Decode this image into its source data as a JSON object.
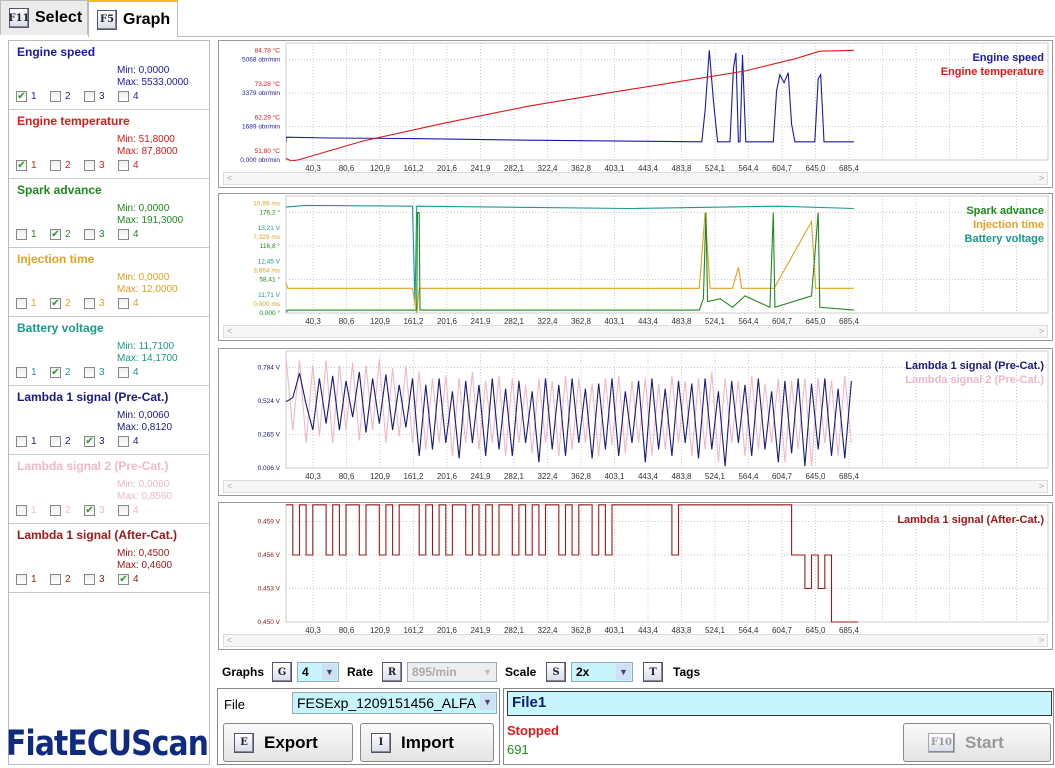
{
  "tabs": [
    {
      "key": "F11",
      "label": "Select"
    },
    {
      "key": "F5",
      "label": "Graph"
    }
  ],
  "signals": [
    {
      "name": "Engine speed",
      "min": "Min: 0,0000",
      "max": "Max: 5533,0000",
      "color": "#1a1aa8",
      "graph": 1
    },
    {
      "name": "Engine temperature",
      "min": "Min: 51,8000",
      "max": "Max: 87,8000",
      "color": "#e01818",
      "graph": 1
    },
    {
      "name": "Spark advance",
      "min": "Min: 0,0000",
      "max": "Max: 191,3000",
      "color": "#1e8a1e",
      "graph": 2
    },
    {
      "name": "Injection time",
      "min": "Min: 0,0000",
      "max": "Max: 12,0000",
      "color": "#e8a020",
      "graph": 2
    },
    {
      "name": "Battery voltage",
      "min": "Min: 11,7100",
      "max": "Max: 14,1700",
      "color": "#1a9a8a",
      "graph": 2
    },
    {
      "name": "Lambda 1 signal (Pre-Cat.)",
      "min": "Min: 0,0060",
      "max": "Max: 0,8120",
      "color": "#1a1a80",
      "graph": 3
    },
    {
      "name": "Lambda signal 2 (Pre-Cat.)",
      "min": "Min: 0,0060",
      "max": "Max: 0,8560",
      "color": "#f0b8c8",
      "graph": 3
    },
    {
      "name": "Lambda 1 signal (After-Cat.)",
      "min": "Min: 0,4500",
      "max": "Max: 0,4600",
      "color": "#a01818",
      "graph": 4
    }
  ],
  "checkbox_labels": [
    "1",
    "2",
    "3",
    "4"
  ],
  "x_ticks": [
    "40,3",
    "80,6",
    "120,9",
    "161,2",
    "201,6",
    "241,9",
    "282,1",
    "322,4",
    "362,8",
    "403,1",
    "443,4",
    "483,8",
    "524,1",
    "564,4",
    "604,7",
    "645,0",
    "685,4"
  ],
  "chart_data": [
    {
      "type": "line",
      "legend": [
        "Engine speed",
        "Engine temperature"
      ],
      "legend_position": "top-right",
      "y_labels": [
        [
          {
            "t": "51,80 °C",
            "c": "#e01818"
          },
          {
            "t": "0,000 obr/min",
            "c": "#1a1aa8"
          }
        ],
        [
          {
            "t": "62,29 °C",
            "c": "#e01818"
          },
          {
            "t": "1689 obr/min",
            "c": "#1a1aa8"
          }
        ],
        [
          {
            "t": "73,28 °C",
            "c": "#e01818"
          },
          {
            "t": "3379 obr/min",
            "c": "#1a1aa8"
          }
        ],
        [
          {
            "t": "84,78 °C",
            "c": "#e01818"
          },
          {
            "t": "5068 obr/min",
            "c": "#1a1aa8"
          }
        ]
      ],
      "series": [
        {
          "name": "Engine speed",
          "color": "#1a1aa8",
          "ylim": [
            0,
            5068
          ],
          "points": [
            [
              0,
              0
            ],
            [
              5,
              0
            ],
            [
              8,
              1150
            ],
            [
              60,
              1110
            ],
            [
              161,
              1080
            ],
            [
              300,
              1000
            ],
            [
              480,
              930
            ],
            [
              508,
              920
            ],
            [
              512,
              2500
            ],
            [
              517,
              5533
            ],
            [
              522,
              3000
            ],
            [
              527,
              920
            ],
            [
              542,
              920
            ],
            [
              546,
              4600
            ],
            [
              549,
              5400
            ],
            [
              552,
              920
            ],
            [
              554,
              920
            ],
            [
              557,
              5300
            ],
            [
              561,
              920
            ],
            [
              594,
              920
            ],
            [
              598,
              3500
            ],
            [
              602,
              4300
            ],
            [
              607,
              3900
            ],
            [
              612,
              4400
            ],
            [
              616,
              1800
            ],
            [
              620,
              920
            ],
            [
              644,
              920
            ],
            [
              648,
              4100
            ],
            [
              651,
              4300
            ],
            [
              655,
              920
            ],
            [
              691,
              920
            ]
          ]
        },
        {
          "name": "Engine temperature",
          "color": "#e01818",
          "ylim": [
            51.8,
            84.78
          ],
          "points": [
            [
              0,
              52.6
            ],
            [
              6,
              52.6
            ],
            [
              14,
              51.5
            ],
            [
              22,
              51.8
            ],
            [
              100,
              58
            ],
            [
              200,
              64
            ],
            [
              300,
              69.5
            ],
            [
              400,
              74
            ],
            [
              480,
              77.5
            ],
            [
              560,
              81
            ],
            [
              620,
              85
            ],
            [
              650,
              87.5
            ],
            [
              691,
              87.8
            ]
          ]
        }
      ]
    },
    {
      "type": "line",
      "legend": [
        "Spark advance",
        "Injection time",
        "Battery voltage"
      ],
      "legend_position": "top-right",
      "y_labels": [
        [
          {
            "t": "11,71 V",
            "c": "#1a9a8a"
          },
          {
            "t": "0,000 ms",
            "c": "#e8a020"
          },
          {
            "t": "0,000 °",
            "c": "#1e8a1e"
          }
        ],
        [
          {
            "t": "12,45 V",
            "c": "#1a9a8a"
          },
          {
            "t": "3,664 ms",
            "c": "#e8a020"
          },
          {
            "t": "58,41 °",
            "c": "#1e8a1e"
          }
        ],
        [
          {
            "t": "13,21 V",
            "c": "#1a9a8a"
          },
          {
            "t": "7,329 ms",
            "c": "#e8a020"
          },
          {
            "t": "116,8 °",
            "c": "#1e8a1e"
          }
        ],
        [
          {
            "t": "10,99 ms",
            "c": "#e8a020"
          },
          {
            "t": "176,2 °",
            "c": "#1e8a1e"
          }
        ]
      ],
      "series": [
        {
          "name": "Battery voltage",
          "color": "#1a9a8a",
          "ylim": [
            11.71,
            13.96
          ],
          "points": [
            [
              0,
              12.0
            ],
            [
              4,
              12.2
            ],
            [
              7,
              14.08
            ],
            [
              30,
              14.12
            ],
            [
              160,
              14.1
            ],
            [
              163,
              11.9
            ],
            [
              165,
              14.1
            ],
            [
              420,
              14.05
            ],
            [
              600,
              14.1
            ],
            [
              691,
              14.05
            ]
          ]
        },
        {
          "name": "Injection time",
          "color": "#e8a020",
          "ylim": [
            0,
            10.99
          ],
          "points": [
            [
              0,
              11
            ],
            [
              3,
              11
            ],
            [
              5,
              4
            ],
            [
              10,
              2.7
            ],
            [
              160,
              2.7
            ],
            [
              165,
              0
            ],
            [
              168,
              2.7
            ],
            [
              505,
              2.7
            ],
            [
              512,
              11
            ],
            [
              518,
              2.7
            ],
            [
              545,
              2.7
            ],
            [
              552,
              5
            ],
            [
              556,
              2.7
            ],
            [
              595,
              2.7
            ],
            [
              640,
              10
            ],
            [
              645,
              2.7
            ],
            [
              691,
              2.7
            ]
          ]
        },
        {
          "name": "Spark advance",
          "color": "#1e8a1e",
          "ylim": [
            0,
            176.2
          ],
          "points": [
            [
              0,
              60
            ],
            [
              5,
              60
            ],
            [
              7,
              0
            ],
            [
              10,
              5
            ],
            [
              165,
              5
            ],
            [
              166,
              176
            ],
            [
              168,
              176
            ],
            [
              169,
              5
            ],
            [
              505,
              5
            ],
            [
              510,
              25
            ],
            [
              513,
              176
            ],
            [
              515,
              20
            ],
            [
              530,
              25
            ],
            [
              545,
              10
            ],
            [
              560,
              30
            ],
            [
              590,
              10
            ],
            [
              594,
              176
            ],
            [
              596,
              10
            ],
            [
              640,
              30
            ],
            [
              648,
              176
            ],
            [
              650,
              10
            ],
            [
              691,
              5
            ]
          ]
        }
      ]
    },
    {
      "type": "line",
      "legend": [
        "Lambda 1 signal (Pre-Cat.)",
        "Lambda signal 2 (Pre-Cat.)"
      ],
      "legend_position": "top-right",
      "y_labels": [
        [
          {
            "t": "0,006 V",
            "c": "#1a1a80"
          }
        ],
        [
          {
            "t": "0,265 V",
            "c": "#1a1a80"
          }
        ],
        [
          {
            "t": "0,524 V",
            "c": "#1a1a80"
          }
        ],
        [
          {
            "t": "0,784 V",
            "c": "#1a1a80"
          }
        ]
      ],
      "x_step": 8,
      "series": [
        {
          "name": "Lambda signal 2 (Pre-Cat.)",
          "color": "#f0b8c8",
          "ylim": [
            0.006,
            0.784
          ],
          "values": [
            0.52,
            0.85,
            0.3,
            0.84,
            0.2,
            0.8,
            0.25,
            0.84,
            0.2,
            0.8,
            0.3,
            0.82,
            0.22,
            0.8,
            0.3,
            0.85,
            0.2,
            0.78,
            0.25,
            0.8,
            0.2,
            0.75,
            0.15,
            0.7,
            0.2,
            0.72,
            0.1,
            0.7,
            0.2,
            0.75,
            0.15,
            0.68,
            0.2,
            0.72,
            0.1,
            0.7,
            0.2,
            0.65,
            0.12,
            0.7,
            0.2,
            0.68,
            0.1,
            0.72,
            0.15,
            0.7,
            0.2,
            0.66,
            0.1,
            0.7,
            0.18,
            0.72,
            0.12,
            0.68,
            0.2,
            0.7,
            0.1,
            0.66,
            0.15,
            0.72,
            0.2,
            0.68,
            0.1,
            0.7,
            0.15,
            0.75,
            0.05,
            0.7,
            0.2,
            0.68,
            0.1,
            0.72,
            0.15,
            0.66,
            0.2,
            0.7,
            0.05,
            0.68,
            0.15,
            0.7,
            0.02,
            0.7,
            0.2,
            0.68,
            0.1,
            0.72,
            0.2
          ]
        },
        {
          "name": "Lambda 1 signal (Pre-Cat.)",
          "color": "#1a1a80",
          "ylim": [
            0.006,
            0.784
          ],
          "values": [
            0.52,
            0.52,
            0.55,
            0.74,
            0.5,
            0.3,
            0.7,
            0.35,
            0.72,
            0.3,
            0.68,
            0.4,
            0.75,
            0.28,
            0.7,
            0.35,
            0.73,
            0.3,
            0.65,
            0.32,
            0.7,
            0.1,
            0.65,
            0.15,
            0.7,
            0.2,
            0.6,
            0.08,
            0.68,
            0.2,
            0.65,
            0.1,
            0.7,
            0.15,
            0.62,
            0.1,
            0.68,
            0.2,
            0.6,
            0.05,
            0.7,
            0.15,
            0.65,
            0.1,
            0.7,
            0.2,
            0.62,
            0.08,
            0.66,
            0.15,
            0.7,
            0.1,
            0.6,
            0.2,
            0.68,
            0.05,
            0.7,
            0.15,
            0.62,
            0.1,
            0.68,
            0.2,
            0.66,
            0.08,
            0.7,
            0.15,
            0.6,
            0.02,
            0.68,
            0.2,
            0.65,
            0.1,
            0.7,
            0.15,
            0.6,
            0.05,
            0.68,
            0.12,
            0.7,
            0.02,
            0.66,
            0.15,
            0.7,
            0.1,
            0.62,
            0.08,
            0.68
          ]
        }
      ]
    },
    {
      "type": "line",
      "legend": [
        "Lambda 1 signal (After-Cat.)"
      ],
      "legend_position": "top-right",
      "y_labels": [
        [
          {
            "t": "0,450 V",
            "c": "#a01818"
          }
        ],
        [
          {
            "t": "0,453 V",
            "c": "#a01818"
          }
        ],
        [
          {
            "t": "0,456 V",
            "c": "#a01818"
          }
        ],
        [
          {
            "t": "0,459 V",
            "c": "#a01818"
          }
        ]
      ],
      "x_step": 8,
      "step": true,
      "series": [
        {
          "name": "Lambda 1 signal (After-Cat.)",
          "color": "#a01818",
          "ylim": [
            0.45,
            0.459
          ],
          "values": [
            0.4605,
            0.4605,
            0.456,
            0.4605,
            0.456,
            0.4605,
            0.4605,
            0.456,
            0.4605,
            0.456,
            0.4605,
            0.4605,
            0.456,
            0.4605,
            0.4605,
            0.456,
            0.4605,
            0.456,
            0.4605,
            0.4605,
            0.4605,
            0.456,
            0.4605,
            0.456,
            0.4605,
            0.456,
            0.4605,
            0.4605,
            0.456,
            0.4605,
            0.456,
            0.4605,
            0.456,
            0.4605,
            0.4605,
            0.456,
            0.4605,
            0.456,
            0.4605,
            0.456,
            0.4605,
            0.4605,
            0.456,
            0.4605,
            0.456,
            0.4605,
            0.4605,
            0.456,
            0.4605,
            0.456,
            0.4605,
            0.4605,
            0.4605,
            0.4605,
            0.4605,
            0.4605,
            0.4605,
            0.4605,
            0.4605,
            0.456,
            0.4605,
            0.4605,
            0.4605,
            0.4605,
            0.4605,
            0.4605,
            0.4605,
            0.4605,
            0.4605,
            0.4605,
            0.4605,
            0.4605,
            0.4605,
            0.4605,
            0.4605,
            0.4605,
            0.4605,
            0.456,
            0.456,
            0.453,
            0.456,
            0.453,
            0.456,
            0.45,
            0.45,
            0.45,
            0.45
          ]
        }
      ]
    }
  ],
  "controls": {
    "graphs_label": "Graphs",
    "graphs_key": "G",
    "graphs_value": "4",
    "rate_label": "Rate",
    "rate_key": "R",
    "rate_value": "895/min",
    "scale_label": "Scale",
    "scale_key": "S",
    "scale_value": "2x",
    "tags_key": "T",
    "tags_label": "Tags"
  },
  "file": {
    "label": "File",
    "value": "FESExp_1209151456_ALFA",
    "export_key": "E",
    "export_label": "Export",
    "import_key": "I",
    "import_label": "Import"
  },
  "status": {
    "name": "File1",
    "state": "Stopped",
    "count": "691",
    "start_key": "F10",
    "start_label": "Start"
  },
  "logo": "FiatECUScan"
}
